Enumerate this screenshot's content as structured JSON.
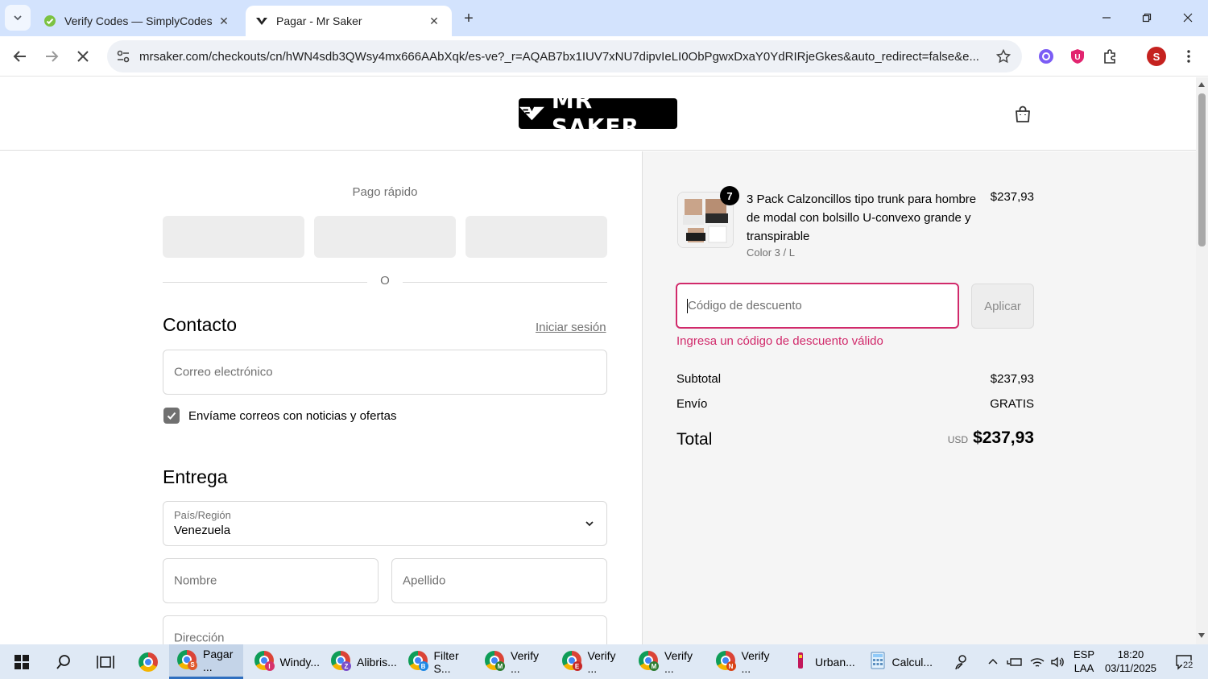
{
  "browser": {
    "tabs": [
      {
        "title": "Verify Codes — SimplyCodes",
        "active": false
      },
      {
        "title": "Pagar - Mr Saker",
        "active": true
      }
    ],
    "url": "mrsaker.com/checkouts/cn/hWN4sdb3QWsy4mx666AAbXqk/es-ve?_r=AQAB7bx1IUV7xNU7dipvIeLI0ObPgwxDxaY0YdRIRjeGkes&auto_redirect=false&e...",
    "profile_initial": "S"
  },
  "site": {
    "logo_text": "MR SAKER"
  },
  "checkout": {
    "express_label": "Pago rápido",
    "divider_text": "O",
    "contact_heading": "Contacto",
    "login_link": "Iniciar sesión",
    "email_placeholder": "Correo electrónico",
    "newsletter_label": "Envíame correos con noticias y ofertas",
    "newsletter_checked": true,
    "delivery_heading": "Entrega",
    "country_label": "País/Región",
    "country_value": "Venezuela",
    "first_name_placeholder": "Nombre",
    "last_name_placeholder": "Apellido",
    "address_placeholder": "Dirección"
  },
  "summary": {
    "product": {
      "quantity": "7",
      "name": "3 Pack Calzoncillos tipo trunk para hombre de modal con bolsillo U-convexo grande y transpirable",
      "variant": "Color 3 / L",
      "price": "$237,93"
    },
    "discount_placeholder": "Código de descuento",
    "apply_label": "Aplicar",
    "discount_error": "Ingresa un código de descuento válido",
    "subtotal_label": "Subtotal",
    "subtotal_value": "$237,93",
    "shipping_label": "Envío",
    "shipping_value": "GRATIS",
    "total_label": "Total",
    "total_currency": "USD",
    "total_value": "$237,93"
  },
  "taskbar": {
    "apps": [
      {
        "label": "Pagar ...",
        "badge": "S",
        "badge_color": "#e05a2b"
      },
      {
        "label": "Windy...",
        "badge": "I",
        "badge_color": "#d6336c"
      },
      {
        "label": "Alibris...",
        "badge": "Z",
        "badge_color": "#7b4fc9"
      },
      {
        "label": "Filter S...",
        "badge": "B",
        "badge_color": "#1e88e5"
      },
      {
        "label": "Verify ...",
        "badge": "M",
        "badge_color": "#2e7d32"
      },
      {
        "label": "Verify ...",
        "badge": "E",
        "badge_color": "#c62828"
      },
      {
        "label": "Verify ...",
        "badge": "M",
        "badge_color": "#2e7d32"
      },
      {
        "label": "Verify ...",
        "badge": "N",
        "badge_color": "#d84315"
      },
      {
        "label": "Urban..."
      },
      {
        "label": "Calcul..."
      }
    ],
    "lang_line1": "ESP",
    "lang_line2": "LAA",
    "time": "18:20",
    "date": "03/11/2025",
    "notifications": "22"
  },
  "colors": {
    "error": "#d12a6b",
    "tabbar": "#d3e3fd",
    "summary_bg": "#f5f5f5"
  }
}
